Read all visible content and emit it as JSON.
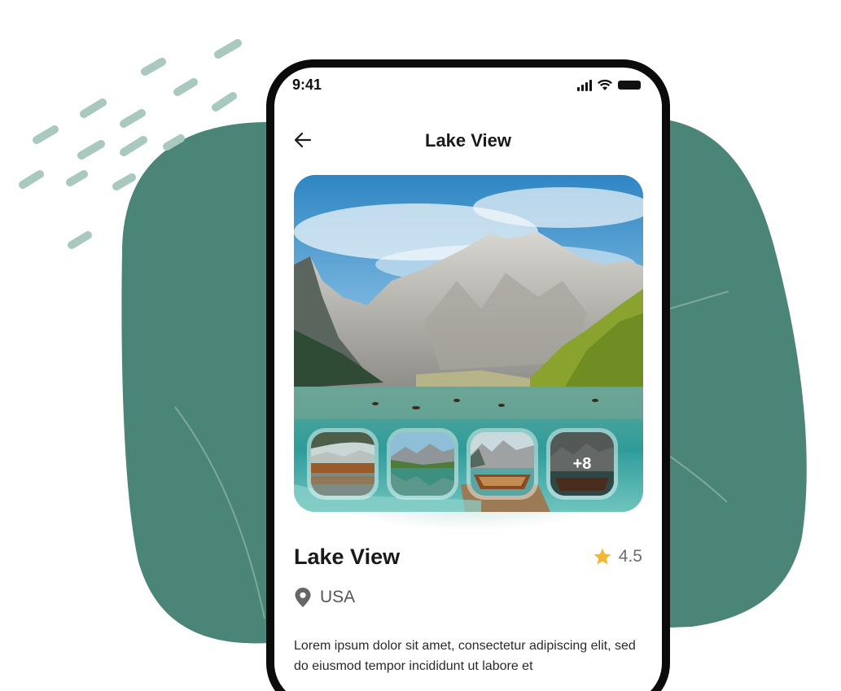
{
  "status_bar": {
    "time": "9:41",
    "icons": [
      "signal-icon",
      "wifi-icon",
      "battery-icon"
    ]
  },
  "header": {
    "back_icon": "arrow-left-icon",
    "title": "Lake View"
  },
  "gallery": {
    "thumbnails": [
      "lake-forest",
      "lake-reflection",
      "boat-mountains",
      "boat-dark"
    ],
    "more_label": "+8"
  },
  "place": {
    "name": "Lake View",
    "rating": "4.5",
    "rating_icon": "star-icon",
    "location_icon": "location-pin-icon",
    "location": "USA",
    "description": "Lorem ipsum dolor sit amet, consectetur adipiscing elit, sed do eiusmod tempor incididunt ut labore et"
  },
  "colors": {
    "blob": "#4a8577",
    "star": "#f4b731",
    "phone_frame": "#0b0b0b",
    "dash": "#a9c8c0"
  }
}
